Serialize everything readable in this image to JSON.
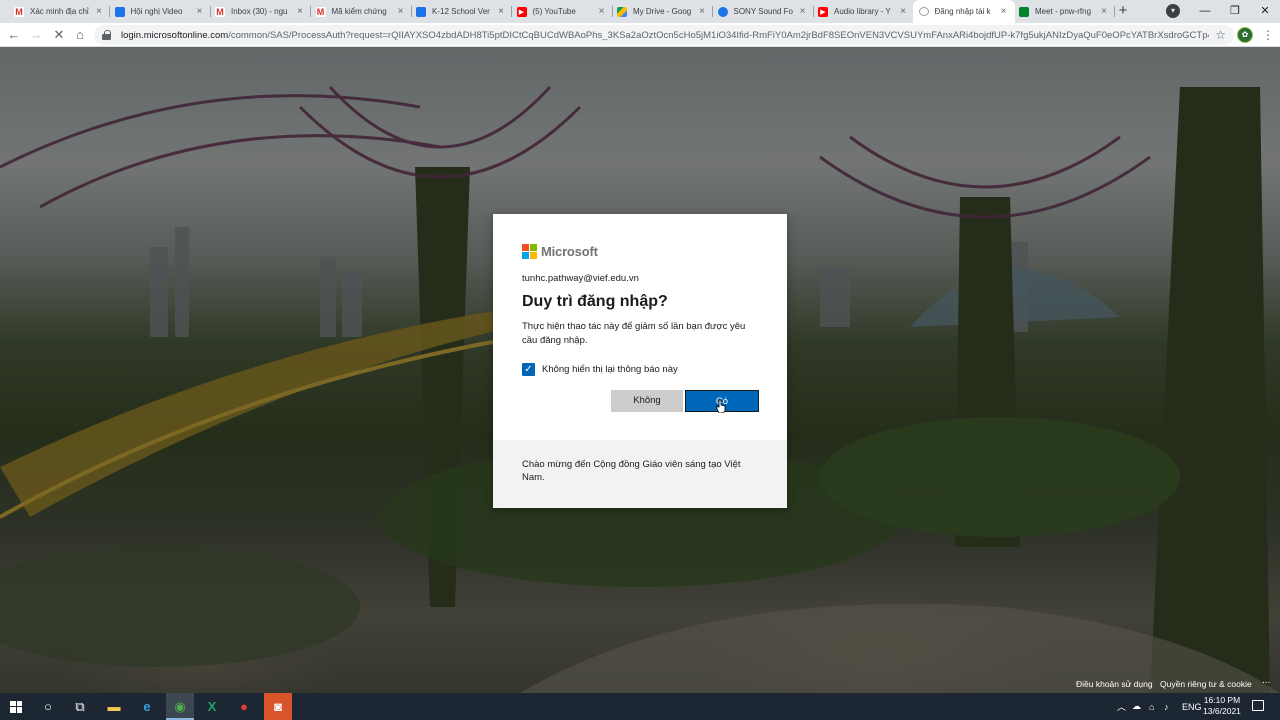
{
  "browser": {
    "tabs": [
      {
        "title": "Xác minh địa chỉ",
        "icon": "gmail-icon",
        "fav": "gmail",
        "fav_text": "M"
      },
      {
        "title": "Hội nghị Video",
        "icon": "meet-icon",
        "fav": "meet",
        "fav_text": ""
      },
      {
        "title": "Inbox (30) - ngu",
        "icon": "gmail-icon",
        "fav": "gmail",
        "fav_text": "M"
      },
      {
        "title": "Mã kiểm chứng",
        "icon": "gmail-icon",
        "fav": "gmail",
        "fav_text": "M"
      },
      {
        "title": "K-12 School Ver",
        "icon": "meet-icon",
        "fav": "meet",
        "fav_text": ""
      },
      {
        "title": "(5) YouTube",
        "icon": "youtube-icon",
        "fav": "yt",
        "fav_text": "▶"
      },
      {
        "title": "My Drive - Goog",
        "icon": "drive-icon",
        "fav": "drive",
        "fav_text": ""
      },
      {
        "title": "SONY Sound Fo",
        "icon": "sony-icon",
        "fav": "sony",
        "fav_text": ""
      },
      {
        "title": "Audio library - Y",
        "icon": "youtube-icon",
        "fav": "yt",
        "fav_text": "▶"
      },
      {
        "title": "Đăng nhập tài k",
        "icon": "loading-icon",
        "fav": "blank",
        "fav_text": "",
        "active": true
      },
      {
        "title": "Meet - pnw-rfng",
        "icon": "google-meet-icon",
        "fav": "gmeet",
        "fav_text": ""
      }
    ],
    "new_tab_symbol": "+",
    "close_symbol": "×",
    "url_host": "login.microsoftonline.com",
    "url_path": "/common/SAS/ProcessAuth?request=rQIIAYXSO4zbdADH8Ti5ptDICtCqBUCdWBAoPhs_3KSa2aOztOcn5cHo5jM1iO34Ifid-RmFiY0Am2jrBdF8SEOnVEN3VCVSUYmFAnxARi4bojdfUP-k7fg5ukjANIzDyaQuF0eOPcYATBrXsdroGCTp4F0U6Bo6..."
  },
  "dialog": {
    "brand": "Microsoft",
    "logo_colors": [
      "#f25022",
      "#7fba00",
      "#00a4ef",
      "#ffb900"
    ],
    "account": "tunhc.pathway@vief.edu.vn",
    "title": "Duy trì đăng nhập?",
    "description": "Thực hiện thao tác này để giảm số lần bạn được yêu cầu đăng nhập.",
    "checkbox_label": "Không hiển thị lại thông báo này",
    "checkbox_checked": true,
    "no_label": "Không",
    "yes_label": "Có",
    "footer_text": "Chào mừng đến Cộng đồng Giáo viên sáng tạo Việt Nam.",
    "accent": "#0067b8"
  },
  "page_footer": {
    "terms": "Điều khoản sử dụng",
    "privacy": "Quyền riêng tư & cookie",
    "more": "..."
  },
  "taskbar": {
    "apps": [
      "start-icon",
      "search-icon",
      "task-view-icon",
      "file-explorer-icon",
      "edge-icon",
      "chrome-icon",
      "excel-icon",
      "camera-recorder-icon",
      "screen-recorder-icon"
    ],
    "tray_language": "ENG",
    "time": "16:10 PM",
    "date": "13/6/2021"
  }
}
